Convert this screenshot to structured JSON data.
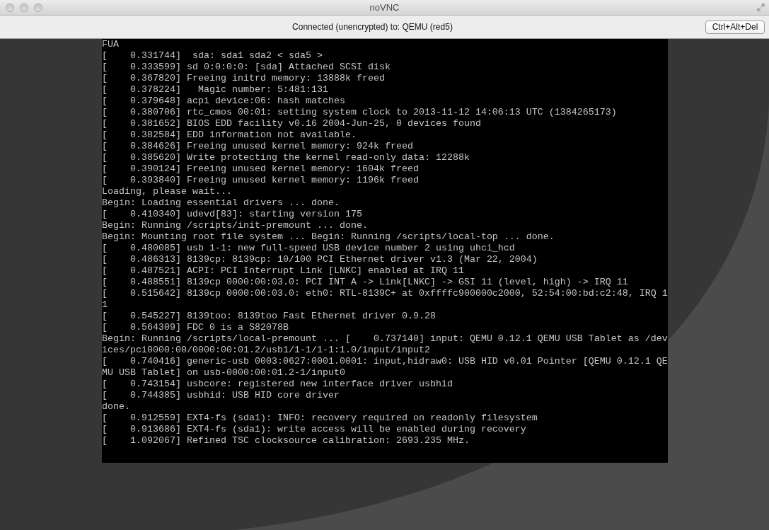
{
  "window": {
    "title": "noVNC"
  },
  "toolbar": {
    "status": "Connected (unencrypted) to: QEMU (red5)",
    "button": "Ctrl+Alt+Del"
  },
  "console": {
    "lines": [
      "FUA",
      "[    0.331744]  sda: sda1 sda2 < sda5 >",
      "[    0.333599] sd 0:0:0:0: [sda] Attached SCSI disk",
      "[    0.367820] Freeing initrd memory: 13888k freed",
      "[    0.378224]   Magic number: 5:481:131",
      "[    0.379648] acpi device:06: hash matches",
      "[    0.380706] rtc_cmos 00:01: setting system clock to 2013-11-12 14:06:13 UTC (1384265173)",
      "[    0.381652] BIOS EDD facility v0.16 2004-Jun-25, 0 devices found",
      "[    0.382584] EDD information not available.",
      "[    0.384626] Freeing unused kernel memory: 924k freed",
      "[    0.385620] Write protecting the kernel read-only data: 12288k",
      "[    0.390124] Freeing unused kernel memory: 1604k freed",
      "[    0.393840] Freeing unused kernel memory: 1196k freed",
      "Loading, please wait...",
      "Begin: Loading essential drivers ... done.",
      "[    0.410340] udevd[83]: starting version 175",
      "Begin: Running /scripts/init-premount ... done.",
      "Begin: Mounting root file system ... Begin: Running /scripts/local-top ... done.",
      "[    0.480085] usb 1-1: new full-speed USB device number 2 using uhci_hcd",
      "[    0.486313] 8139cp: 8139cp: 10/100 PCI Ethernet driver v1.3 (Mar 22, 2004)",
      "[    0.487521] ACPI: PCI Interrupt Link [LNKC] enabled at IRQ 11",
      "[    0.488551] 8139cp 0000:00:03.0: PCI INT A -> Link[LNKC] -> GSI 11 (level, high) -> IRQ 11",
      "[    0.515642] 8139cp 0000:00:03.0: eth0: RTL-8139C+ at 0xffffc900000c2000, 52:54:00:bd:c2:48, IRQ 1",
      "1",
      "[    0.545227] 8139too: 8139too Fast Ethernet driver 0.9.28",
      "[    0.564309] FDC 0 is a S82078B",
      "Begin: Running /scripts/local-premount ... [    0.737140] input: QEMU 0.12.1 QEMU USB Tablet as /dev",
      "ices/pci0000:00/0000:00:01.2/usb1/1-1/1-1:1.0/input/input2",
      "[    0.740416] generic-usb 0003:0627:0001.0001: input,hidraw0: USB HID v0.01 Pointer [QEMU 0.12.1 QE",
      "MU USB Tablet] on usb-0000:00:01.2-1/input0",
      "[    0.743154] usbcore: registered new interface driver usbhid",
      "[    0.744385] usbhid: USB HID core driver",
      "done.",
      "[    0.912559] EXT4-fs (sda1): INFO: recovery required on readonly filesystem",
      "[    0.913686] EXT4-fs (sda1): write access will be enabled during recovery",
      "[    1.092067] Refined TSC clocksource calibration: 2693.235 MHz."
    ]
  }
}
